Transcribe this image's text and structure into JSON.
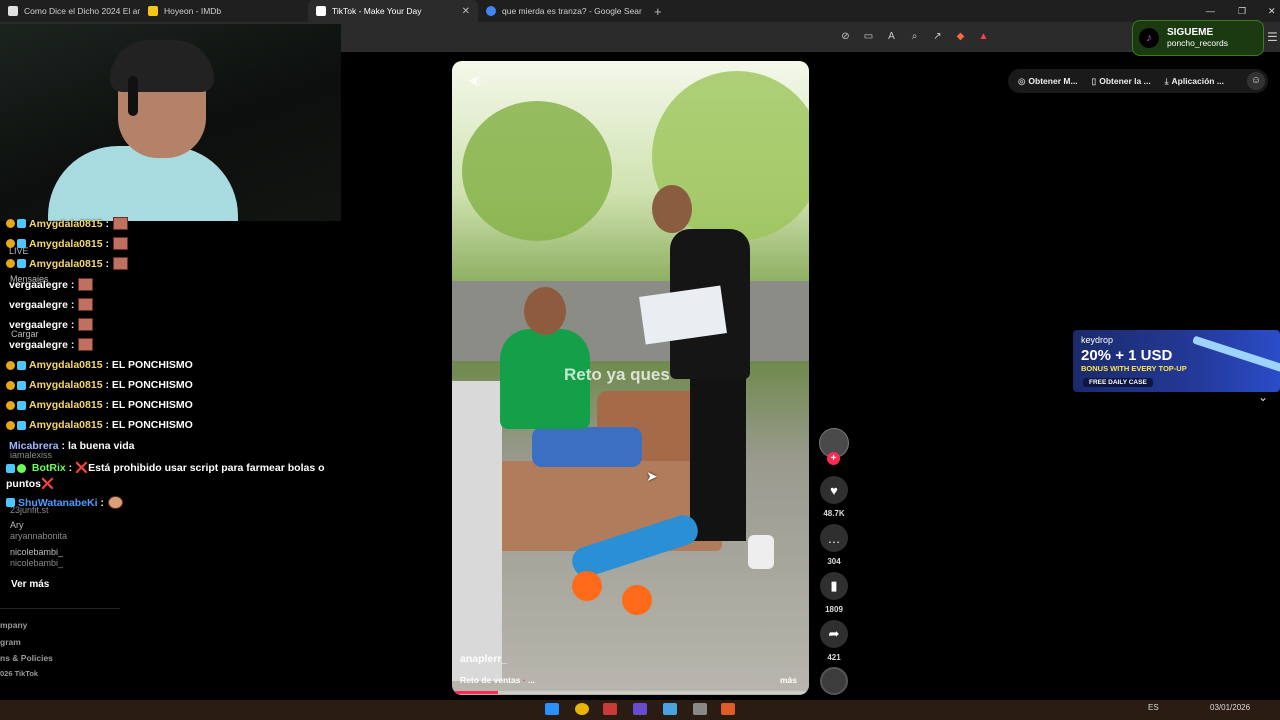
{
  "browser": {
    "tabs": [
      {
        "title": "Como Dice el Dicho 2024 El amor es",
        "favicon_color": "#e0e0e0"
      },
      {
        "title": "Hoyeon - IMDb",
        "favicon_color": "#f5c518"
      },
      {
        "title": "TikTok - Make Your Day",
        "favicon_color": "#ffffff"
      },
      {
        "title": "que mierda es tranza? - Google Sear",
        "favicon_color": "#4285f4"
      }
    ],
    "new_tab": "+",
    "close": "✕"
  },
  "follow_badge": {
    "line1": "SIGUEME",
    "line2": "poncho_records"
  },
  "chat": {
    "messages": [
      {
        "user": "Amygdala0815",
        "text": ""
      },
      {
        "user": "Amygdala0815",
        "text": ""
      },
      {
        "user": "Amygdala0815",
        "text": ""
      },
      {
        "user": "vergaalegre",
        "text": ""
      },
      {
        "user": "vergaalegre",
        "text": ""
      },
      {
        "user": "vergaalegre",
        "text": ""
      },
      {
        "user": "vergaalegre",
        "text": ""
      },
      {
        "user": "Amygdala0815",
        "text": "EL PONCHISMO"
      },
      {
        "user": "Amygdala0815",
        "text": "EL PONCHISMO"
      },
      {
        "user": "Amygdala0815",
        "text": "EL PONCHISMO"
      },
      {
        "user": "Amygdala0815",
        "text": "EL PONCHISMO"
      },
      {
        "user": "Micabrera",
        "text": "la buena vida"
      },
      {
        "user": "BotRix",
        "text": "❌Está prohibido usar script para farmear bolas o puntos❌"
      },
      {
        "user": "ShuWatanabeKi",
        "text": ""
      }
    ],
    "ghost_labels": [
      "LIVE",
      "Mensajes",
      "Cargar",
      "iamalexiss",
      "23junfit.st",
      "Ary",
      "aryannabonita",
      "nicolebambi_",
      "nicolebambi_"
    ]
  },
  "sidebar": {
    "see_more": "Ver más",
    "footer": [
      "mpany",
      "gram",
      "ns & Policies",
      "026 TikTok"
    ]
  },
  "video": {
    "overlay_text": "Reto ya ques",
    "author": "anaplerr_",
    "description": "Reto de ventas",
    "more": "más",
    "progress": 0.13
  },
  "actions": {
    "likes": "48.7K",
    "comments": "304",
    "saves": "1809",
    "shares": "421"
  },
  "topbar": {
    "pill1": "Obtener M...",
    "pill2": "Obtener la ...",
    "pill3": "Aplicación ..."
  },
  "ad": {
    "brand": "keydrop",
    "headline": "20% + 1 USD",
    "sub": "BONUS WITH EVERY TOP-UP",
    "cta": "FREE DAILY CASE"
  },
  "tray": {
    "lang": "ES",
    "date": "03/01/2026"
  },
  "colors": {
    "accent": "#fe2c55",
    "username": "#f5d76e",
    "bot": "#6cff5a",
    "ad_bg": "#243a9a"
  }
}
